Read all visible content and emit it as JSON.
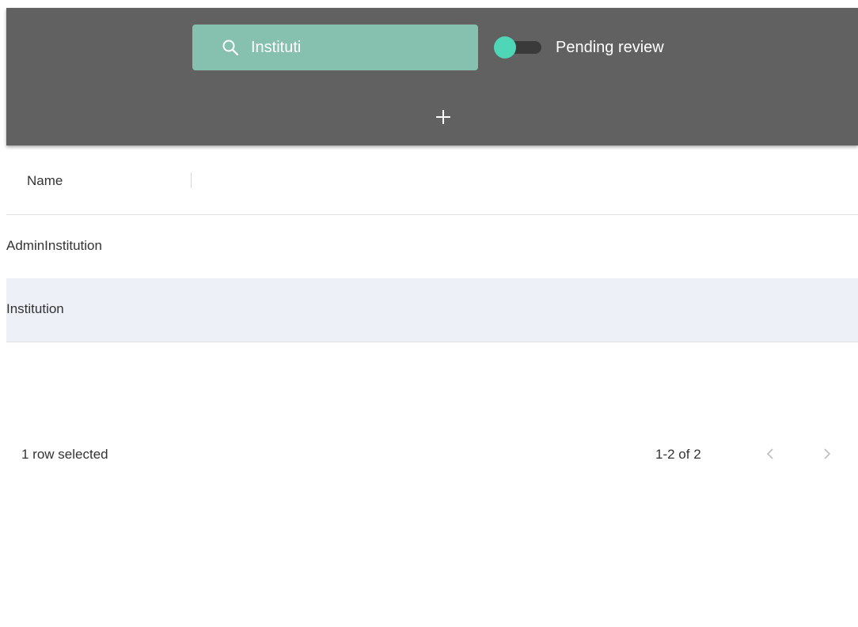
{
  "toolbar": {
    "search": {
      "value": "Instituti",
      "icon": "search-icon"
    },
    "toggle": {
      "label": "Pending review",
      "checked": true,
      "thumb_color": "#4fd6b6"
    },
    "add_icon": "plus-icon",
    "background_color": "#616161",
    "search_background_color": "#85c1ae"
  },
  "table": {
    "columns": [
      {
        "label": "Name"
      }
    ],
    "rows": [
      {
        "name": "AdminInstitution",
        "selected": false
      },
      {
        "name": "Institution",
        "selected": true
      }
    ],
    "selected_row_color": "#eef0f8"
  },
  "footer": {
    "selection_text": "1 row selected",
    "range_text": "1-2 of 2",
    "prev_icon": "chevron-left-icon",
    "next_icon": "chevron-right-icon"
  }
}
